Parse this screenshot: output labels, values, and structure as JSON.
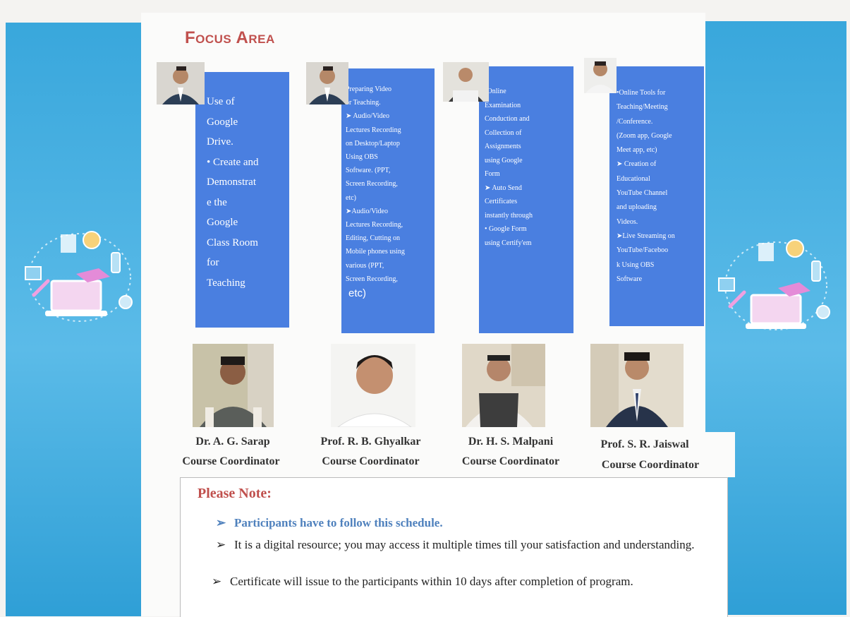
{
  "title": "Focus Area",
  "cards": [
    {
      "text": "Use of\nGoogle\nDrive.\n• Create and\nDemonstrat\ne the\nGoogle\nClass Room\nfor\nTeaching"
    },
    {
      "text": "Preparing Video\nor Teaching.\n➤ Audio/Video\nLectures Recording\non Desktop/Laptop\nUsing OBS\nSoftware. (PPT,\nScreen Recording,\netc)\n➤Audio/Video\nLectures Recording,\nEditing, Cutting on\nMobile phones using\nvarious (PPT,\nScreen Recording,",
      "extra": "etc)"
    },
    {
      "text": "•Online\nExamination\nConduction and\nCollection of\nAssignments\nusing Google\nForm\n➤ Auto Send\nCertificates\ninstantly through\n• Google Form\nusing Certify'em"
    },
    {
      "text": "•Online Tools for\nTeaching/Meeting\n/Conference.\n(Zoom app, Google\nMeet app, etc)\n➤ Creation of\nEducational\nYouTube Channel\nand uploading\nVideos.\n➤Live Streaming on\nYouTube/Faceboo\nk Using OBS\nSoftware"
    }
  ],
  "coordinators": [
    {
      "name": "Dr. A. G. Sarap",
      "role": "Course Coordinator"
    },
    {
      "name": "Prof. R. B. Ghyalkar",
      "role": "Course Coordinator"
    },
    {
      "name": "Dr. H. S. Malpani",
      "role": "Course Coordinator"
    },
    {
      "name": "Prof. S. R. Jaiswal",
      "role": "Course Coordinator"
    }
  ],
  "note": {
    "title": "Please Note:",
    "items": [
      "Participants have to follow this schedule.",
      "It is a digital resource; you may access it multiple times till your satisfaction and understanding.",
      "Certificate will issue to the participants within 10 days after completion of program."
    ]
  },
  "colors": {
    "accent": "#c0504d",
    "card": "#4a7fe0",
    "side": "#39a7dc",
    "highlight": "#4f81bd"
  }
}
